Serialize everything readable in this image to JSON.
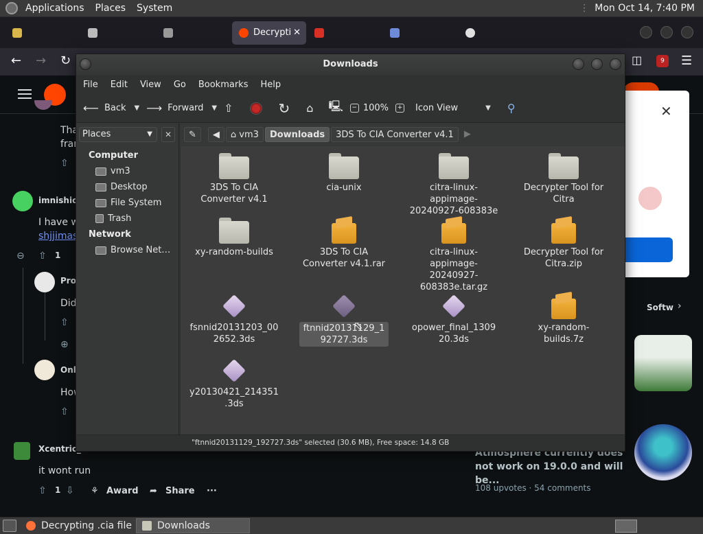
{
  "top_panel": {
    "menus": [
      "Applications",
      "Places",
      "System"
    ],
    "clock": "Mon Oct 14,  7:40 PM"
  },
  "browser": {
    "tabs": [
      {
        "label": "",
        "color": "#d8b64a"
      },
      {
        "label": "",
        "color": "#bbbbbb"
      },
      {
        "label": "",
        "color": "#999999"
      },
      {
        "label": "Decrypti",
        "color": "#ff4500",
        "active": true
      },
      {
        "label": "",
        "color": "#d93025"
      },
      {
        "label": "",
        "color": "#6d8bd8"
      },
      {
        "label": "",
        "color": "#e0e0e0"
      }
    ],
    "badge": "9"
  },
  "reddit": {
    "comment1_text": "Tha",
    "comment1_text2": "fran",
    "comment2_user": "imnishio",
    "comment2_text": "I have w",
    "comment2_link": "shjjimase",
    "comment2_votes": "1",
    "comment3_user": "Pro",
    "comment3_text": "Did",
    "comment4_user": "Onl",
    "comment4_text": "How",
    "comment5_user": "Xcentric_",
    "comment5_text": "it wont run",
    "comment5_votes": "1",
    "award_label": "Award",
    "share_label": "Share",
    "more_label": "···",
    "side_section": "Softw",
    "side_title": "Atmosphere currently does not work on 19.0.0 and will be...",
    "side_meta": "108 upvotes  ·  54 comments",
    "colors": {
      "brand": "#ff4500",
      "link": "#7193ff"
    }
  },
  "fm": {
    "title": "Downloads",
    "menus": [
      "File",
      "Edit",
      "View",
      "Go",
      "Bookmarks",
      "Help"
    ],
    "toolbar": {
      "back": "Back",
      "forward": "Forward",
      "zoom": "100%",
      "view_mode": "Icon View"
    },
    "sidebar": {
      "selector": "Places",
      "sections": [
        {
          "heading": "Computer",
          "items": [
            "vm3",
            "Desktop",
            "File System",
            "Trash"
          ]
        },
        {
          "heading": "Network",
          "items": [
            "Browse Net…"
          ]
        }
      ]
    },
    "breadcrumbs": [
      "vm3",
      "Downloads",
      "3DS To CIA Converter v4.1"
    ],
    "files": [
      {
        "name": "3DS To CIA Converter v4.1",
        "type": "folder"
      },
      {
        "name": "cia-unix",
        "type": "folder"
      },
      {
        "name": "citra-linux-appimage-20240927-608383e",
        "type": "folder"
      },
      {
        "name": "Decrypter Tool for Citra",
        "type": "folder"
      },
      {
        "name": "xy-random-builds",
        "type": "folder"
      },
      {
        "name": "3DS To CIA Converter v4.1.rar",
        "type": "archive"
      },
      {
        "name": "citra-linux-appimage-20240927-608383e.tar.gz",
        "type": "archive"
      },
      {
        "name": "Decrypter Tool for Citra.zip",
        "type": "archive"
      },
      {
        "name": "fsnnid20131203_002652.3ds",
        "type": "rom"
      },
      {
        "name": "ftnnid20131129_192727.3ds",
        "type": "rom",
        "selected": true
      },
      {
        "name": "opower_final_130920.3ds",
        "type": "rom"
      },
      {
        "name": "xy-random-builds.7z",
        "type": "archive"
      },
      {
        "name": "y20130421_214351.3ds",
        "type": "rom"
      }
    ],
    "status": "\"ftnnid20131129_192727.3ds\" selected (30.6 MB), Free space: 14.8 GB"
  },
  "taskbar": {
    "tasks": [
      {
        "label": "Decrypting .cia file : ...",
        "color": "#ff7139"
      },
      {
        "label": "Downloads",
        "color": "#c8c8b8",
        "active": true
      }
    ]
  }
}
